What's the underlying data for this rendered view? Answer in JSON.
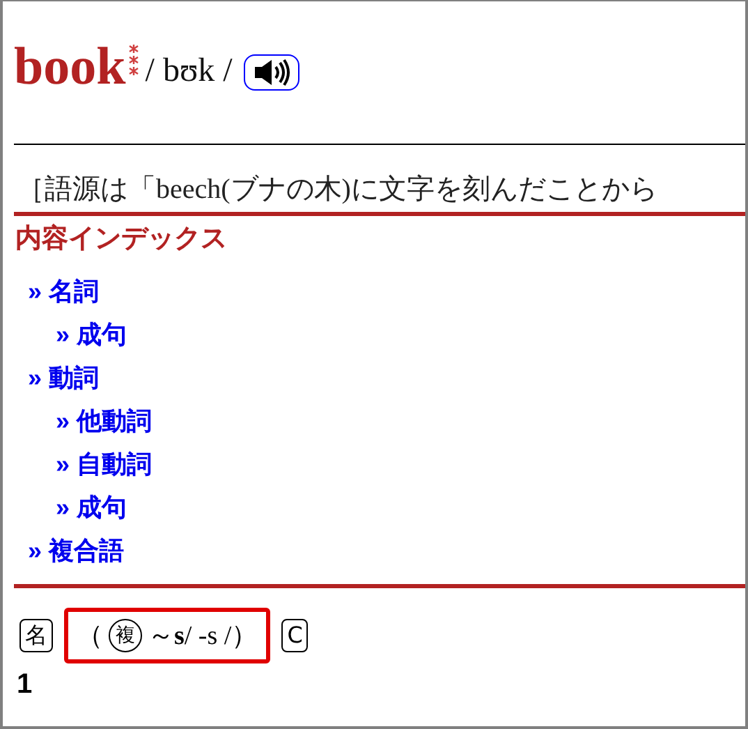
{
  "headword": {
    "word": "book",
    "pronunciation": "/ bʊk /"
  },
  "etymology": "［語源は「beech(ブナの木)に文字を刻んだことから",
  "index": {
    "title": "内容インデックス",
    "bullet": "»",
    "items": [
      {
        "label": "名詞",
        "children": [
          {
            "label": "成句"
          }
        ]
      },
      {
        "label": "動詞",
        "children": [
          {
            "label": "他動詞"
          },
          {
            "label": "自動詞"
          },
          {
            "label": "成句"
          }
        ]
      },
      {
        "label": "複合語"
      }
    ]
  },
  "grammar": {
    "pos": "名",
    "open": "（",
    "plural_mark": "複",
    "forms": "～**s**/ -s /）",
    "countability": "C"
  },
  "sense_number": "1"
}
